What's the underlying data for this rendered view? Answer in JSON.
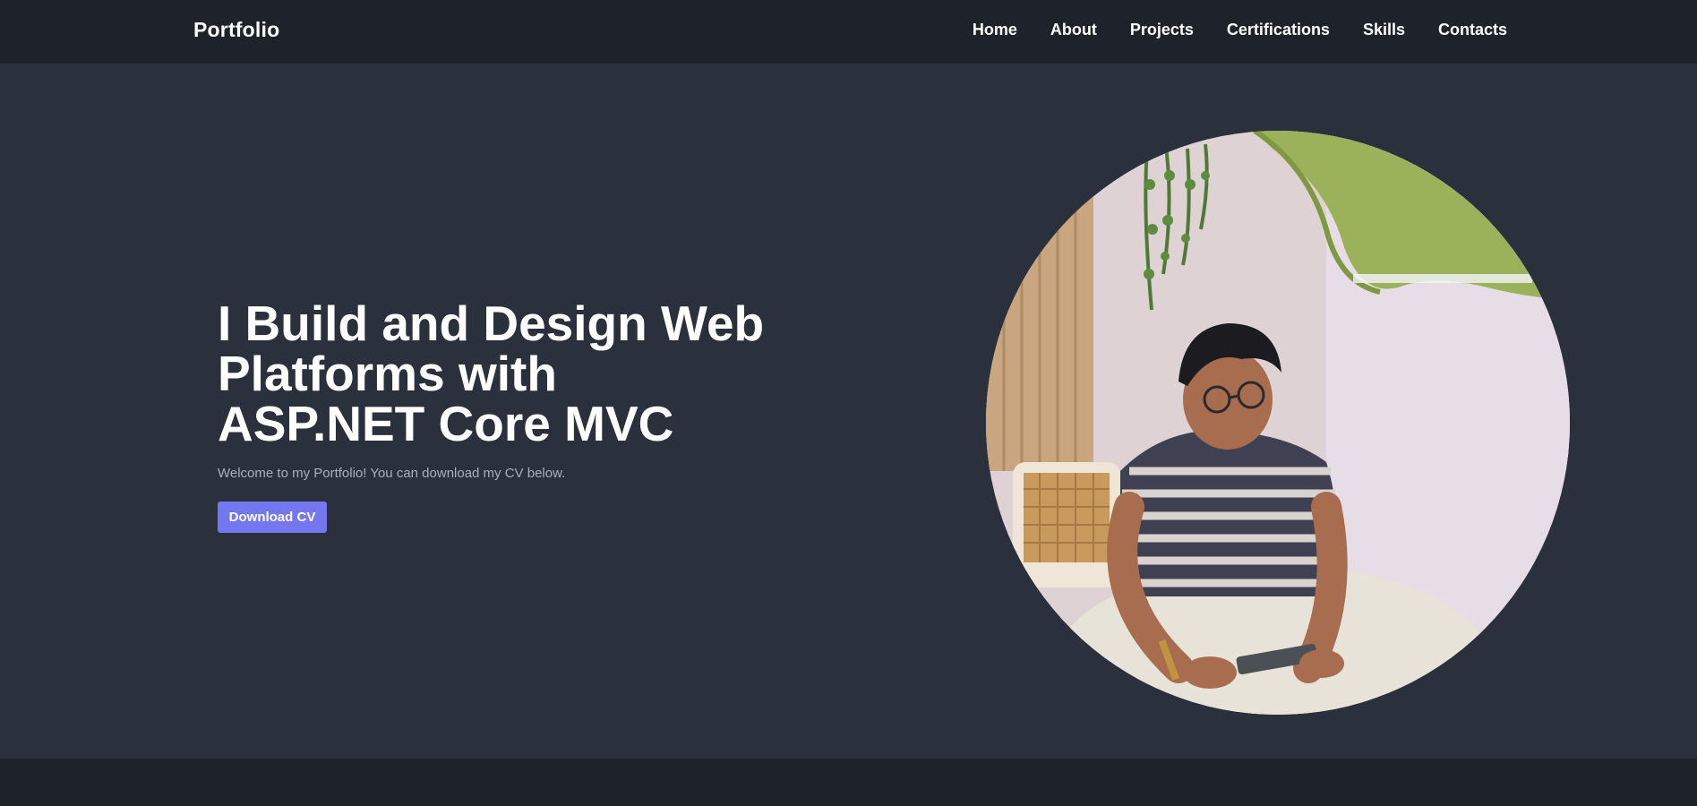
{
  "navbar": {
    "brand": "Portfolio",
    "links": [
      "Home",
      "About",
      "Projects",
      "Certifications",
      "Skills",
      "Contacts"
    ]
  },
  "hero": {
    "headline": "I Build and Design Web\nPlatforms with\nASP.NET Core MVC",
    "subtitle": "Welcome to my Portfolio! You can download my CV below.",
    "cta_label": "Download CV"
  },
  "colors": {
    "nav_bg": "#1e232b",
    "hero_bg": "#2a313c",
    "accent": "#7477ef",
    "subtitle": "#a9b0bc"
  }
}
